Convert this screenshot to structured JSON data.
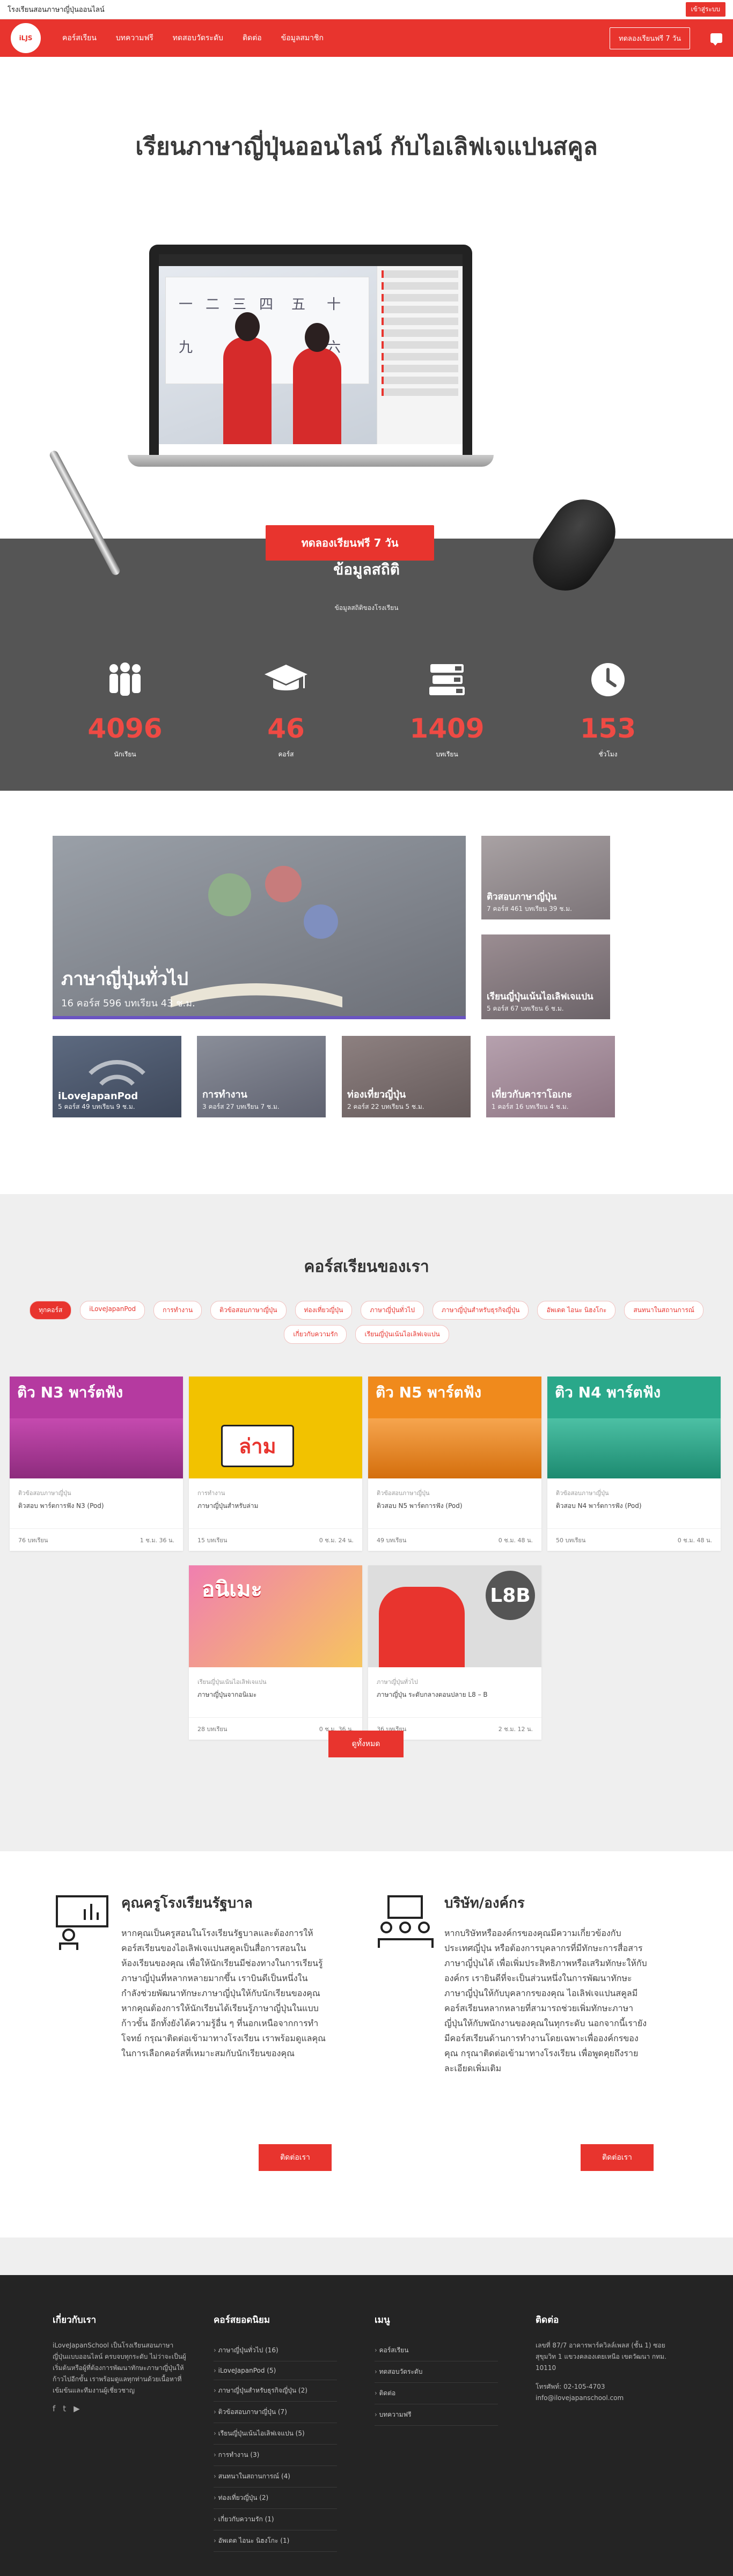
{
  "topbar": {
    "title": "โรงเรียนสอนภาษาญี่ปุ่นออนไลน์",
    "login": "เข้าสู่ระบบ"
  },
  "nav": {
    "logo_text": "iLJS",
    "items": [
      "คอร์สเรียน",
      "บทความฟรี",
      "ทดสอบวัดระดับ",
      "ติดต่อ",
      "ข้อมูลสมาชิก"
    ],
    "trial": "ทดลองเรียนฟรี 7 วัน"
  },
  "hero": {
    "title": "เรียนภาษาญี่ปุ่นออนไลน์ กับไอเลิฟเจแปนสคูล",
    "button": "ทดลองเรียนฟรี 7 วัน",
    "board_chars": [
      "一",
      "二",
      "三",
      "四",
      "五",
      "九",
      "十",
      "六"
    ]
  },
  "stats": {
    "title": "ข้อมูลสถิติ",
    "subtitle": "ข้อมูลสถิติของโรงเรียน",
    "items": [
      {
        "icon": "users-icon",
        "num": "4096",
        "label": "นักเรียน"
      },
      {
        "icon": "graduation-cap-icon",
        "num": "46",
        "label": "คอร์ส"
      },
      {
        "icon": "books-icon",
        "num": "1409",
        "label": "บทเรียน"
      },
      {
        "icon": "clock-icon",
        "num": "153",
        "label": "ชั่วโมง"
      }
    ]
  },
  "categories": [
    {
      "title": "ภาษาญี่ปุ่นทั่วไป",
      "sub": "16 คอร์ส 596 บทเรียน 43 ช.ม."
    },
    {
      "title": "ติวสอบภาษาญี่ปุ่น",
      "sub": "7 คอร์ส 461 บทเรียน 39 ช.ม."
    },
    {
      "title": "เรียนญี่ปุ่นเน้นไอเลิฟเจแปน",
      "sub": "5 คอร์ส 67 บทเรียน 6 ช.ม."
    },
    {
      "title": "iLoveJapanPod",
      "sub": "5 คอร์ส 49 บทเรียน 9 ช.ม."
    },
    {
      "title": "การทำงาน",
      "sub": "3 คอร์ส 27 บทเรียน 7 ช.ม."
    },
    {
      "title": "ท่องเที่ยวญี่ปุ่น",
      "sub": "2 คอร์ส 22 บทเรียน 5 ช.ม."
    },
    {
      "title": "เที่ยวกับคาราโอเกะ",
      "sub": "1 คอร์ส 16 บทเรียน 4 ช.ม."
    }
  ],
  "courses": {
    "title": "คอร์สเรียนของเรา",
    "filters": [
      "ทุกคอร์ส",
      "iLoveJapanPod",
      "การทำงาน",
      "ติวข้อสอบภาษาญี่ปุ่น",
      "ท่องเที่ยวญี่ปุ่น",
      "ภาษาญี่ปุ่นทั่วไป",
      "ภาษาญี่ปุ่นสำหรับธุรกิจญี่ปุ่น",
      "อัพเดต ไอนะ นิฮงโกะ",
      "สนทนาในสถานการณ์",
      "เกี่ยวกับความรัก",
      "เรียนญี่ปุ่นเน้นไอเลิฟเจแปน"
    ],
    "cards": [
      {
        "banner": "ติว N3 พาร์ตฟัง",
        "cat": "ติวข้อสอบภาษาญี่ปุ่น",
        "title": "ติวสอบ พาร์ตการฟัง N3 (Pod)",
        "lessons": "76 บทเรียน",
        "hours": "1 ช.ม. 36 น.",
        "color": "#b53aa0"
      },
      {
        "banner": "ล่าม",
        "cat": "การทำงาน",
        "title": "ภาษาญี่ปุ่นสำหรับล่าม",
        "lessons": "15 บทเรียน",
        "hours": "0 ช.ม. 24 น.",
        "color": "#f2c200"
      },
      {
        "banner": "ติว N5 พาร์ตฟัง",
        "cat": "ติวข้อสอบภาษาญี่ปุ่น",
        "title": "ติวสอบ N5 พาร์ตการฟัง (Pod)",
        "lessons": "49 บทเรียน",
        "hours": "0 ช.ม. 48 น.",
        "color": "#f08a1c"
      },
      {
        "banner": "ติว N4 พาร์ตฟัง",
        "cat": "ติวข้อสอบภาษาญี่ปุ่น",
        "title": "ติวสอบ N4 พาร์ตการฟัง (Pod)",
        "lessons": "50 บทเรียน",
        "hours": "0 ช.ม. 48 น.",
        "color": "#2aa88a"
      },
      {
        "banner": "อนิเมะ",
        "cat": "เรียนญี่ปุ่นเน้นไอเลิฟเจแปน",
        "title": "ภาษาญี่ปุ่นจากอนิเมะ",
        "lessons": "28 บทเรียน",
        "hours": "0 ช.ม. 36 น.",
        "color": "#f07fb0"
      },
      {
        "banner": "L8B",
        "cat": "ภาษาญี่ปุ่นทั่วไป",
        "title": "ภาษาญี่ปุ่น ระดับกลางตอนปลาย L8 – B",
        "lessons": "36 บทเรียน",
        "hours": "2 ช.ม. 12 น.",
        "color": "#e8342e"
      }
    ],
    "more": "ดูทั้งหมด"
  },
  "promo": {
    "left": {
      "title": "คุณครูโรงเรียนรัฐบาล",
      "text": "หากคุณเป็นครูสอนในโรงเรียนรัฐบาลและต้องการให้คอร์สเรียนของไอเลิฟเจแปนสคูลเป็นสื่อการสอนในห้องเรียนของคุณ เพื่อให้นักเรียนมีช่องทางในการเรียนรู้ภาษาญี่ปุ่นที่หลากหลายมากขึ้น เราบินดีเป็นหนึ่งในกำลังช่วยพัฒนาทักษะภาษาญี่ปุ่นให้กับนักเรียนของคุณ หากคุณต้องการให้นักเรียนได้เรียนรู้ภาษาญี่ปุ่นในแบบก้าวขั้น อีกทั้งยังได้ความรู้อื่น ๆ ที่นอกเหนือจากการทำโจทย์ กรุณาติดต่อเข้ามาทางโรงเรียน เราพร้อมดูแลคุณในการเลือกคอร์สที่เหมาะสมกับนักเรียนของคุณ",
      "button": "ติดต่อเรา"
    },
    "right": {
      "title": "บริษัท/องค์กร",
      "text": "หากบริษัทหรือองค์กรของคุณมีความเกี่ยวข้องกับประเทศญี่ปุ่น หรือต้องการบุคลากรที่มีทักษะการสื่อสารภาษาญี่ปุ่นได้ เพื่อเพิ่มประสิทธิภาพหรือเสริมทักษะให้กับองค์กร เรายินดีที่จะเป็นส่วนหนึ่งในการพัฒนาทักษะภาษาญี่ปุ่นให้กับบุคลากรของคุณ ไอเลิฟเจแปนสคูลมีคอร์สเรียนหลากหลายที่สามารถช่วยเพิ่มทักษะภาษาญี่ปุ่นให้กับพนักงานของคุณในทุกระดับ นอกจากนี้เรายังมีคอร์สเรียนด้านการทำงานโดยเฉพาะเพื่อองค์กรของคุณ กรุณาติดต่อเข้ามาทางโรงเรียน เพื่อพูดคุยถึงรายละเอียดเพิ่มเติม",
      "button": "ติดต่อเรา"
    }
  },
  "footer": {
    "about": {
      "title": "เกี่ยวกับเรา",
      "text": "iLoveJapanSchool เป็นโรงเรียนสอนภาษาญี่ปุ่นแบบออนไลน์ ครบจบทุกระดับ ไม่ว่าจะเป็นผู้เริ่มต้นหรือผู้ที่ต้องการพัฒนาทักษะภาษาญี่ปุ่นให้ก้าวไปอีกขั้น เราพร้อมดูแลทุกท่านด้วยเนื้อหาที่เข้มข้นและทีมงานผู้เชี่ยวชาญ"
    },
    "courses": {
      "title": "คอร์สยอดนิยม",
      "links": [
        "ภาษาญี่ปุ่นทั่วไป (16)",
        "iLoveJapanPod (5)",
        "ภาษาญี่ปุ่นสำหรับธุรกิจญี่ปุ่น (2)",
        "ติวข้อสอบภาษาญี่ปุ่น (7)",
        "เรียนญี่ปุ่นเน้นไอเลิฟเจแปน (5)",
        "การทำงาน (3)",
        "สนทนาในสถานการณ์ (4)",
        "ท่องเที่ยวญี่ปุ่น (2)",
        "เกี่ยวกับความรัก (1)",
        "อัพเดต ไอนะ นิฮงโกะ (1)"
      ]
    },
    "menu": {
      "title": "เมนู",
      "links": [
        "คอร์สเรียน",
        "ทดสอบวัดระดับ",
        "ติดต่อ",
        "บทความฟรี"
      ]
    },
    "contact": {
      "title": "ติดต่อ",
      "address": "เลขที่ 87/7 อาคารพาร์ควิลล์เพลส (ชั้น 1) ซอยสุขุมวิท 1 แขวงคลองเตยเหนือ เขตวัฒนา กทม. 10110",
      "phone": "โทรศัพท์: 02-105-4703",
      "email": "info@ilovejapanschool.com"
    }
  }
}
